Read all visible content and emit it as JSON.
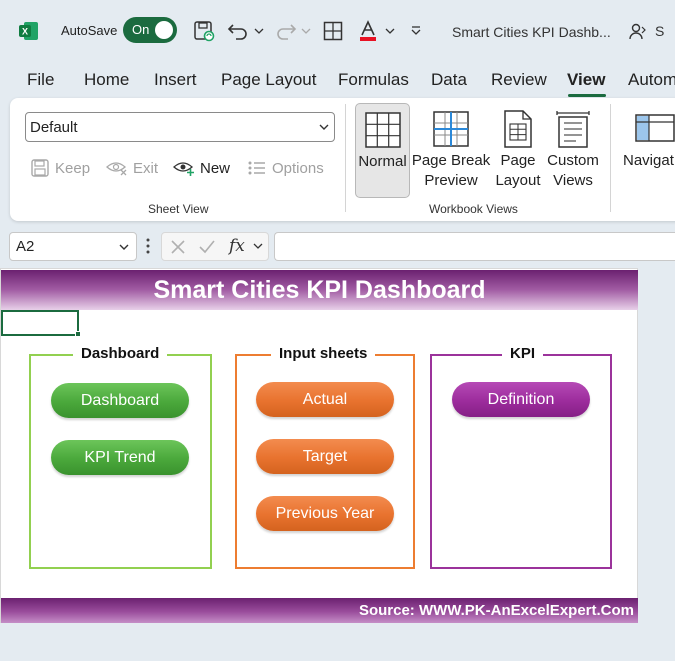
{
  "titlebar": {
    "app_icon": "excel-logo",
    "autosave_label": "AutoSave",
    "autosave_state": "On",
    "document_title": "Smart Cities KPI Dashb...",
    "trailing_letter": "S",
    "icons": [
      "save-icon",
      "undo-icon",
      "redo-icon",
      "borders-icon",
      "font-color-icon",
      "customize-quick-access-icon",
      "share-icon"
    ]
  },
  "ribbon_tabs": [
    "File",
    "Home",
    "Insert",
    "Page Layout",
    "Formulas",
    "Data",
    "Review",
    "View",
    "Autom"
  ],
  "active_tab": "View",
  "sheet_view": {
    "select_value": "Default",
    "buttons": [
      {
        "label": "Keep",
        "icon": "keep-icon",
        "enabled": false
      },
      {
        "label": "Exit",
        "icon": "exit-icon",
        "enabled": false
      },
      {
        "label": "New",
        "icon": "new-view-icon",
        "enabled": true
      },
      {
        "label": "Options",
        "icon": "options-icon",
        "enabled": false
      }
    ],
    "group_label": "Sheet View"
  },
  "workbook_views": {
    "buttons": [
      {
        "label_1": "Normal",
        "label_2": "",
        "icon": "normal-view-icon",
        "selected": true
      },
      {
        "label_1": "Page Break",
        "label_2": "Preview",
        "icon": "page-break-preview-icon",
        "selected": false
      },
      {
        "label_1": "Page",
        "label_2": "Layout",
        "icon": "page-layout-icon",
        "selected": false
      },
      {
        "label_1": "Custom",
        "label_2": "Views",
        "icon": "custom-views-icon",
        "selected": false
      }
    ],
    "group_label": "Workbook Views"
  },
  "navigation": {
    "label": "Navigat",
    "icon": "navigation-icon"
  },
  "formula_bar": {
    "name_box": "A2",
    "fx_label": "fx",
    "formula": ""
  },
  "dashboard": {
    "title": "Smart Cities KPI Dashboard",
    "groups": [
      {
        "title": "Dashboard",
        "color": "#92d050",
        "buttons": [
          "Dashboard",
          "KPI Trend"
        ]
      },
      {
        "title": "Input sheets",
        "color": "#ed7d31",
        "buttons": [
          "Actual",
          "Target",
          "Previous Year"
        ]
      },
      {
        "title": "KPI",
        "color": "#9b339b",
        "buttons": [
          "Definition"
        ]
      }
    ],
    "footer": "Source: WWW.PK-AnExcelExpert.Com"
  },
  "colors": {
    "accent_green": "#1b6b3f",
    "header_purple": "#6b2170",
    "button_green": "#4aa83b",
    "button_orange": "#e8722e",
    "button_purple": "#9c2c9c"
  }
}
